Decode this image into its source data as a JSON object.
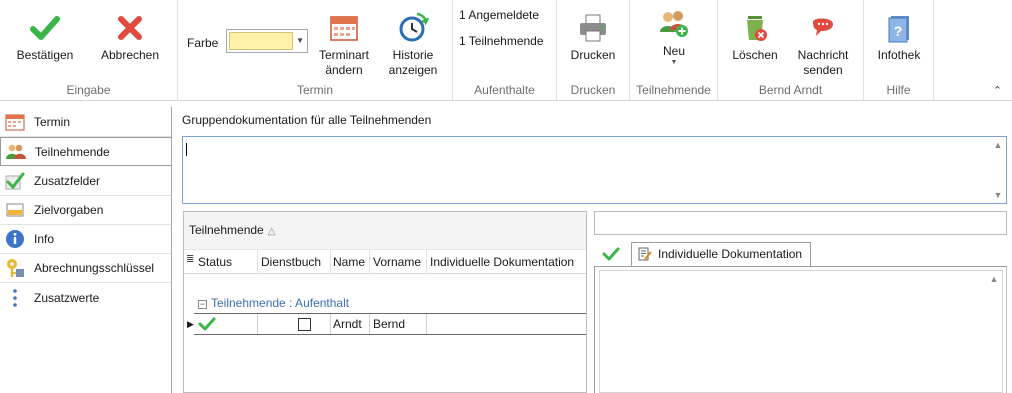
{
  "ribbon": {
    "eingabe": {
      "label": "Eingabe",
      "confirm": "Bestätigen",
      "cancel": "Abbrechen"
    },
    "termin": {
      "label": "Termin",
      "farbe_label": "Farbe",
      "farbe_value": "#fff2a8",
      "terminart_l1": "Terminart",
      "terminart_l2": "ändern",
      "historie_l1": "Historie",
      "historie_l2": "anzeigen"
    },
    "aufenthalte": {
      "label": "Aufenthalte",
      "angemeldete": "1 Angemeldete",
      "teilnehmende": "1 Teilnehmende"
    },
    "drucken": {
      "label": "Drucken",
      "button": "Drucken"
    },
    "teilnehmende": {
      "label": "Teilnehmende",
      "neu": "Neu"
    },
    "person": {
      "label": "Bernd Arndt",
      "loeschen": "Löschen",
      "nachricht_l1": "Nachricht",
      "nachricht_l2": "senden"
    },
    "hilfe": {
      "label": "Hilfe",
      "infothek": "Infothek"
    }
  },
  "sidebar": {
    "items": [
      {
        "label": "Termin",
        "icon": "calendar-icon"
      },
      {
        "label": "Teilnehmende",
        "icon": "people-icon"
      },
      {
        "label": "Zusatzfelder",
        "icon": "checkmark-icon"
      },
      {
        "label": "Zielvorgaben",
        "icon": "target-icon"
      },
      {
        "label": "Info",
        "icon": "info-icon"
      },
      {
        "label": "Abrechnungsschlüssel",
        "icon": "key-icon"
      },
      {
        "label": "Zusatzwerte",
        "icon": "dots-icon"
      }
    ]
  },
  "main": {
    "group_doc_label": "Gruppendokumentation für alle Teilnehmenden",
    "group_doc_value": ""
  },
  "grid": {
    "group_by": "Teilnehmende",
    "columns": [
      "Status",
      "Dienstbuch",
      "Name",
      "Vorname",
      "Individuelle Dokumentation"
    ],
    "group_row": "Teilnehmende : Aufenthalt",
    "rows": [
      {
        "status": "ok",
        "dienstbuch": false,
        "name": "Arndt",
        "vorname": "Bernd",
        "doc": ""
      }
    ]
  },
  "right": {
    "field_value": "",
    "tab_label": "Individuelle Dokumentation"
  },
  "colors": {
    "accent_green": "#3bb54a",
    "cancel_red": "#e04a3f",
    "group_blue": "#3a6fb0",
    "selection_border": "#7ba2d1"
  }
}
